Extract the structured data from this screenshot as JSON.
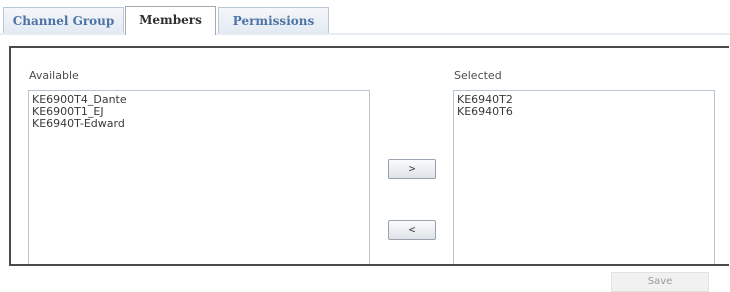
{
  "tabs": {
    "channel_group": "Channel Group",
    "members": "Members",
    "permissions": "Permissions"
  },
  "members_panel": {
    "available_heading": "Available",
    "selected_heading": "Selected",
    "available_items": [
      "KE6900T4_Dante",
      "KE6900T1_EJ",
      "KE6940T-Edward"
    ],
    "selected_items": [
      "KE6940T2",
      "KE6940T6"
    ],
    "move_right_label": ">",
    "move_left_label": "<"
  },
  "actions": {
    "save_label": "Save"
  },
  "colors": {
    "tab_text": "#4d72a4",
    "active_tab_text": "#2f2f2f",
    "panel_border": "#4a4a4a",
    "list_border": "#b8c4d2"
  }
}
